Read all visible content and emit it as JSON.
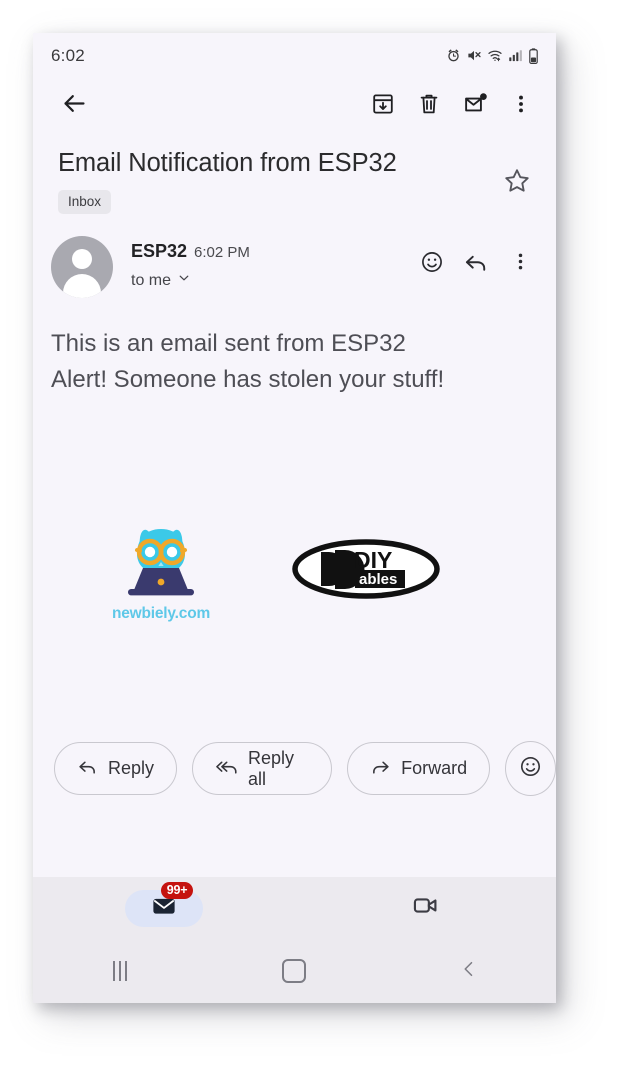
{
  "status_bar": {
    "time": "6:02",
    "icons": [
      "alarm-icon",
      "mute-icon",
      "wifi-icon",
      "signal-icon",
      "battery-icon"
    ]
  },
  "toolbar": {
    "back_icon": "back-arrow-icon",
    "archive_icon": "archive-icon",
    "delete_icon": "trash-icon",
    "mark_unread_icon": "mark-unread-icon",
    "overflow_icon": "more-vertical-icon"
  },
  "email": {
    "subject": "Email Notification from ESP32",
    "label": "Inbox",
    "star_icon": "star-outline-icon",
    "sender_name": "ESP32",
    "sender_time": "6:02 PM",
    "recipient": "to me",
    "recipient_chevron_icon": "chevron-down-icon",
    "emoji_icon": "emoji-smiley-icon",
    "reply_icon": "reply-arrow-icon",
    "overflow_icon": "more-vertical-icon",
    "body_line1": "This is an email sent from ESP32",
    "body_line2": "Alert! Someone has stolen your stuff!"
  },
  "signature": {
    "newbiely": {
      "name": "newbiely.com",
      "logo_icon": "owl-laptop-logo",
      "owl_color": "#3bc9e8",
      "glasses_color": "#f0a829",
      "laptop_color": "#3a3a6e",
      "text_color": "#5ec8e8"
    },
    "diyables": {
      "brand_top": "DIY",
      "brand_bottom": "ables",
      "logo_icon": "diyables-logo"
    }
  },
  "actions": {
    "reply_label": "Reply",
    "reply_icon": "reply-arrow-icon",
    "reply_all_label": "Reply all",
    "reply_all_icon": "reply-all-arrow-icon",
    "forward_label": "Forward",
    "forward_icon": "forward-arrow-icon",
    "emoji_icon": "emoji-smiley-icon"
  },
  "bottom_nav": {
    "mail_icon": "mail-icon",
    "mail_badge": "99+",
    "meet_icon": "video-camera-icon"
  },
  "android_nav": {
    "recents_icon": "recents-icon",
    "home_icon": "home-icon",
    "back_icon": "back-chevron-icon"
  }
}
